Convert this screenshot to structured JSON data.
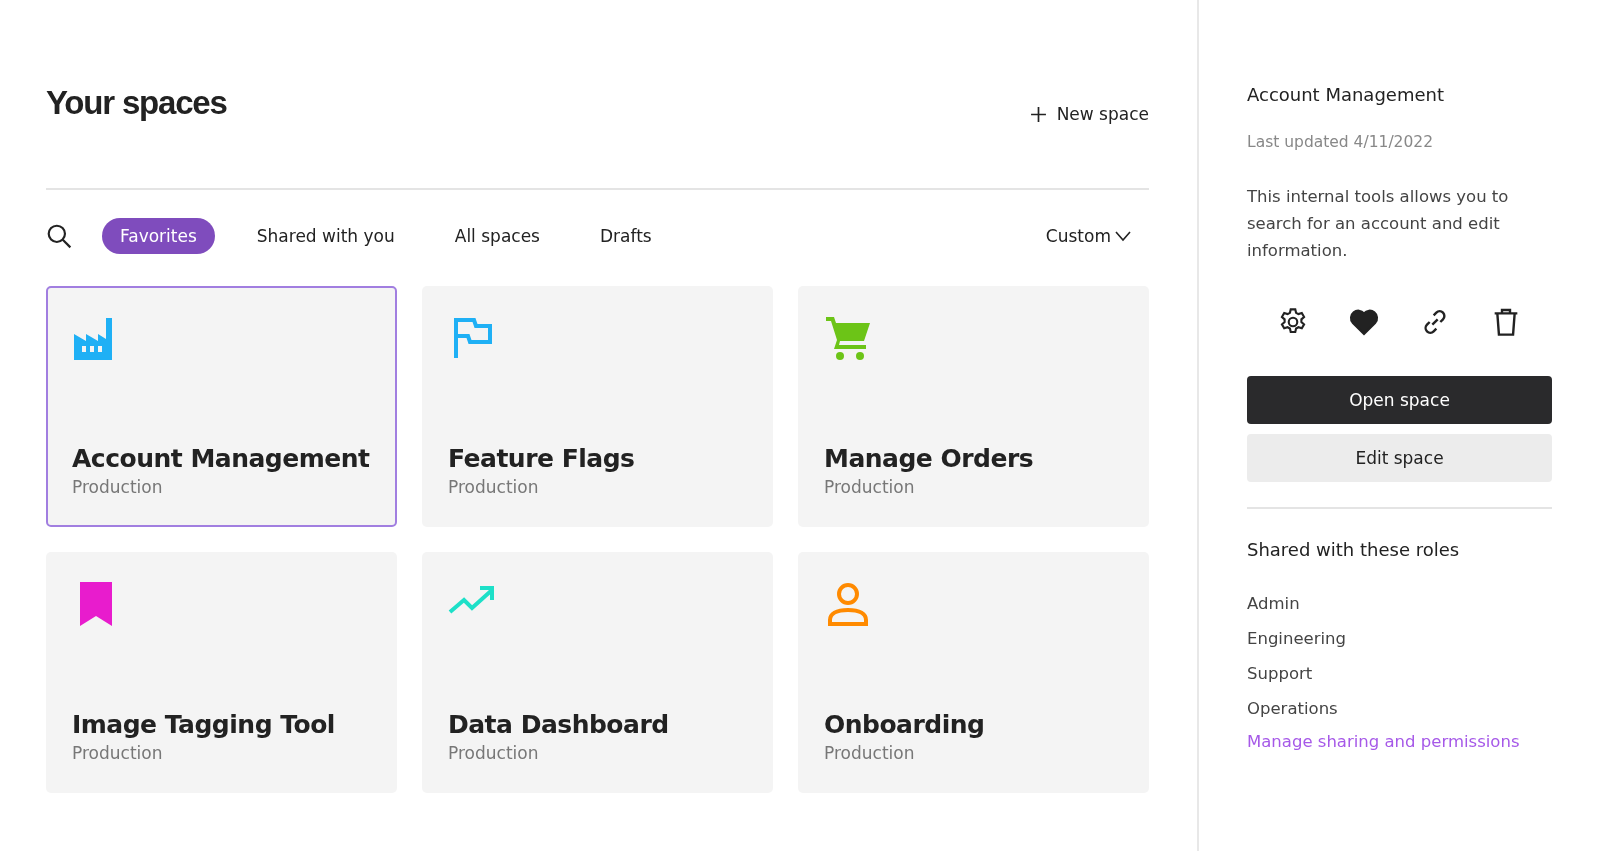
{
  "header": {
    "title": "Your spaces",
    "new_space": "New space"
  },
  "tabs": [
    {
      "label": "Favorites",
      "selected": true
    },
    {
      "label": "Shared with you",
      "selected": false
    },
    {
      "label": "All spaces",
      "selected": false
    },
    {
      "label": "Drafts",
      "selected": false
    }
  ],
  "sort": {
    "label": "Custom"
  },
  "spaces": [
    {
      "name": "Account Management",
      "environment": "Production",
      "kind": "factory",
      "color": "#1fb0f5",
      "selected": true
    },
    {
      "name": "Feature Flags",
      "environment": "Production",
      "kind": "flag",
      "color": "#1fb0f5",
      "selected": false
    },
    {
      "name": "Manage Orders",
      "environment": "Production",
      "kind": "cart",
      "color": "#6cc417",
      "selected": false
    },
    {
      "name": "Image Tagging Tool",
      "environment": "Production",
      "kind": "bookmark",
      "color": "#e81ccd",
      "selected": false
    },
    {
      "name": "Data Dashboard",
      "environment": "Production",
      "kind": "trend",
      "color": "#1de0c8",
      "selected": false
    },
    {
      "name": "Onboarding",
      "environment": "Production",
      "kind": "person",
      "color": "#ff8a00",
      "selected": false
    }
  ],
  "details": {
    "title": "Account Management",
    "updated": "Last updated 4/11/2022",
    "description": "This internal tools allows you to search for an account and edit information.",
    "favorite": true,
    "open_button": "Open space",
    "edit_button": "Edit space",
    "roles_heading": "Shared with these roles",
    "roles": [
      "Admin",
      "Engineering",
      "Support",
      "Operations"
    ],
    "manage_link": "Manage sharing and permissions"
  }
}
